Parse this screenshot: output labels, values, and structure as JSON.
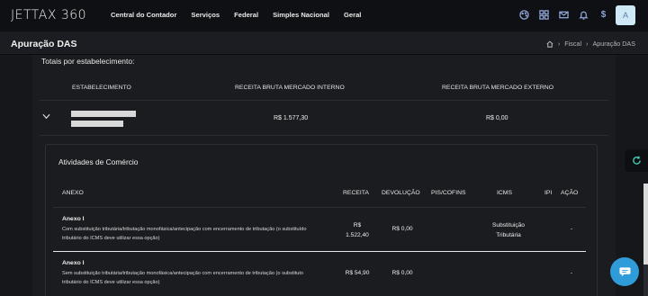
{
  "app": {
    "logo": "JETTAX 360",
    "nav": [
      "Central do Contador",
      "Serviços",
      "Federal",
      "Simples Nacional",
      "Geral"
    ],
    "top_icons": [
      "palette-icon",
      "grid-icon",
      "mail-icon",
      "bell-icon",
      "dollar-icon"
    ],
    "avatar_letter": "A"
  },
  "page": {
    "title": "Apuração DAS",
    "breadcrumb": [
      "Fiscal",
      "Apuração DAS"
    ]
  },
  "totais": {
    "title": "Totais por estabelecimento:",
    "columns": [
      "ESTABELECIMENTO",
      "RECEITA BRUTA MERCADO INTERNO",
      "RECEITA BRUTA MERCADO EXTERNO"
    ],
    "row": {
      "interno": "R$ 1.577,30",
      "externo": "R$ 0,00"
    }
  },
  "atividades": {
    "title": "Atividades de Comércio",
    "columns": {
      "anexo": "ANEXO",
      "receita": "RECEITA",
      "devolucao": "DEVOLUÇÃO",
      "pis": "PIS/COFINS",
      "icms": "ICMS",
      "ipi": "IPI",
      "acao": "AÇÃO"
    },
    "rows": [
      {
        "name": "Anexo I",
        "desc": "Com substituição tributária/tributação monofásica/antecipação com encerramento de tributação (o substituído tributário do ICMS deve utilizar essa opção)",
        "receita_1": "R$",
        "receita_2": "1.522,40",
        "devolucao": "R$ 0,00",
        "icms_1": "Substituição",
        "icms_2": "Tributária",
        "acao": "-"
      },
      {
        "name": "Anexo I",
        "desc": "Sem substituição tributária/tributação monofásica/antecipação com encerramento de tributação (o substituto tributário do ICMS deve utilizar essa opção)",
        "receita": "R$ 54,90",
        "devolucao": "R$ 0,00",
        "acao": "-"
      }
    ]
  }
}
